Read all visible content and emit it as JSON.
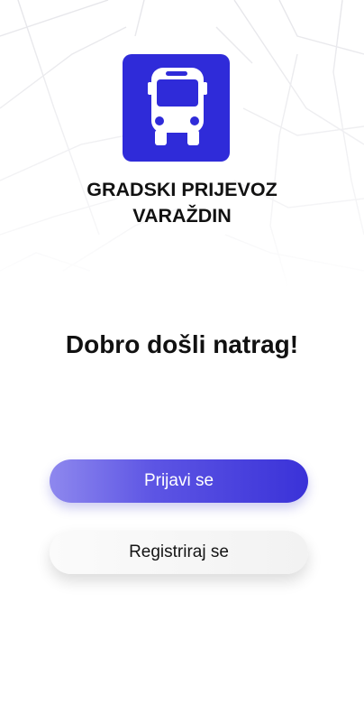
{
  "app": {
    "logo_icon": "bus-icon",
    "title_line1": "GRADSKI PRIJEVOZ",
    "title_line2": "VARAŽDIN"
  },
  "welcome": {
    "heading": "Dobro došli natrag!"
  },
  "actions": {
    "login_label": "Prijavi se",
    "register_label": "Registriraj se"
  },
  "colors": {
    "brand": "#2f2bd9",
    "login_gradient_start": "#8e88ee",
    "login_gradient_end": "#3a32d8",
    "register_bg": "#f4f4f4",
    "text": "#111111"
  }
}
